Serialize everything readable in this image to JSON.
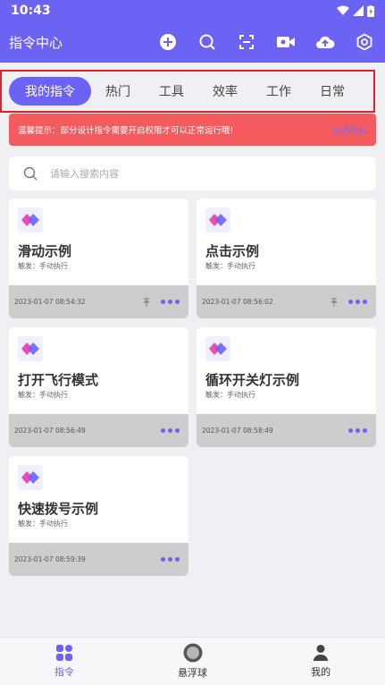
{
  "status": {
    "time": "10:43"
  },
  "appbar": {
    "title": "指令中心",
    "icons": [
      "add-circle-icon",
      "search-icon",
      "scan-icon",
      "video-record-icon",
      "cloud-upload-icon",
      "settings-hexagon-icon"
    ]
  },
  "tabs": [
    {
      "label": "我的指令",
      "active": true
    },
    {
      "label": "热门"
    },
    {
      "label": "工具"
    },
    {
      "label": "效率"
    },
    {
      "label": "工作"
    },
    {
      "label": "日常"
    }
  ],
  "notice": {
    "text": "温馨提示：部分设计指令需要开启权限才可以正常运行哦!",
    "action": "点此开启"
  },
  "search": {
    "placeholder": "请输入搜索内容"
  },
  "cards": [
    {
      "name": "滑动示例",
      "trigger": "触发：手动执行",
      "date": "2023-01-07 08:54:32",
      "pinned": true
    },
    {
      "name": "点击示例",
      "trigger": "触发：手动执行",
      "date": "2023-01-07 08:56:02",
      "pinned": true
    },
    {
      "name": "打开飞行模式",
      "trigger": "触发：手动执行",
      "date": "2023-01-07 08:56:49",
      "pinned": false
    },
    {
      "name": "循环开关灯示例",
      "trigger": "触发：手动执行",
      "date": "2023-01-07 08:58:49",
      "pinned": false
    },
    {
      "name": "快速拨号示例",
      "trigger": "触发：手动执行",
      "date": "2023-01-07 08:59:39",
      "pinned": false
    }
  ],
  "bottomnav": [
    {
      "label": "指令",
      "icon": "grid-icon",
      "active": true
    },
    {
      "label": "悬浮球",
      "icon": "floating-ball-icon"
    },
    {
      "label": "我的",
      "icon": "user-icon"
    }
  ],
  "colors": {
    "primary": "#6c63f5",
    "notice": "#f45b5e",
    "tab_highlight_border": "#e0242c"
  }
}
